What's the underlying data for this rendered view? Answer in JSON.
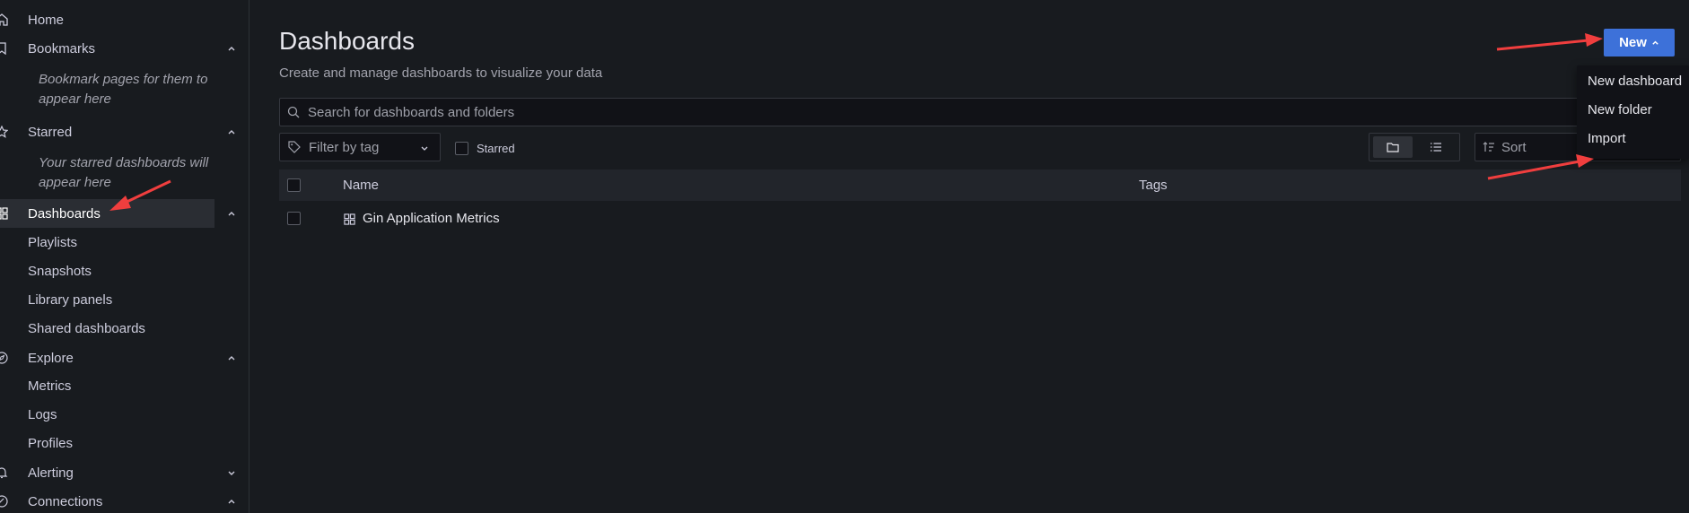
{
  "sidebar": {
    "home": "Home",
    "bookmarks": "Bookmarks",
    "bookmarks_note": "Bookmark pages for them to appear here",
    "starred": "Starred",
    "starred_note": "Your starred dashboards will appear here",
    "dashboards": "Dashboards",
    "dashboards_children": [
      "Playlists",
      "Snapshots",
      "Library panels",
      "Shared dashboards"
    ],
    "explore": "Explore",
    "explore_children": [
      "Metrics",
      "Logs",
      "Profiles"
    ],
    "alerting": "Alerting",
    "connections": "Connections"
  },
  "header": {
    "title": "Dashboards",
    "subtitle": "Create and manage dashboards to visualize your data",
    "new_button": "New"
  },
  "new_menu": [
    "New dashboard",
    "New folder",
    "Import"
  ],
  "search": {
    "placeholder": "Search for dashboards and folders"
  },
  "filters": {
    "tag_filter": "Filter by tag",
    "starred": "Starred",
    "sort": "Sort"
  },
  "table": {
    "columns": [
      "Name",
      "Tags"
    ],
    "rows": [
      {
        "name": "Gin Application Metrics",
        "tags": ""
      }
    ]
  },
  "colors": {
    "background": "#181b1f",
    "primary_button": "#3d71d9",
    "annotation_arrow": "#f03e3e"
  },
  "icons": {
    "home": "home-icon",
    "bookmarks": "bookmark-icon",
    "starred": "star-icon",
    "dashboards": "apps-icon",
    "explore": "compass-icon",
    "alerting": "bell-icon",
    "connections": "link-icon",
    "search": "search-icon",
    "tag": "tag-icon",
    "folder_view": "folder-icon",
    "list_view": "list-icon",
    "sort": "sort-icon"
  }
}
